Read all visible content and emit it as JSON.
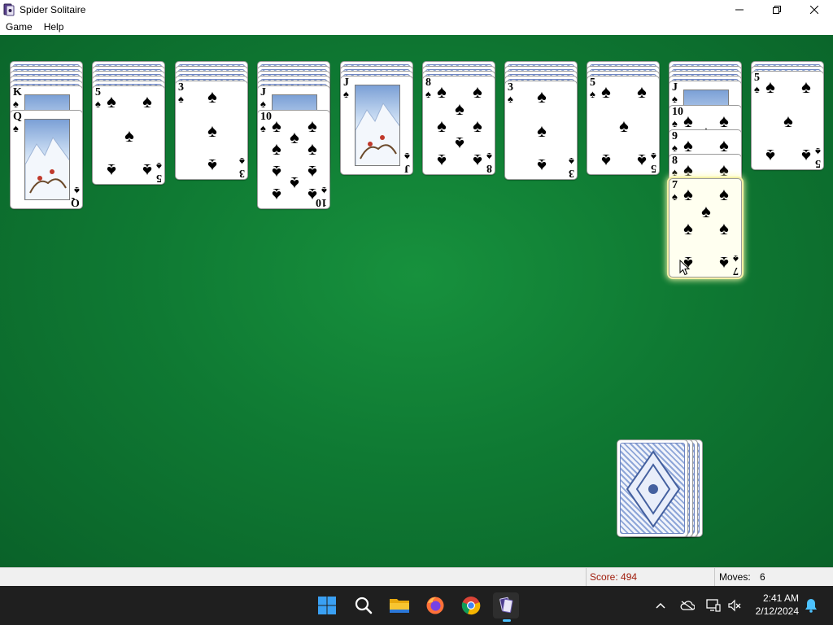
{
  "window": {
    "title": "Spider Solitaire",
    "controls": [
      "minimize-icon",
      "restore-icon",
      "close-icon"
    ]
  },
  "menu": [
    {
      "label": "Game"
    },
    {
      "label": "Help"
    }
  ],
  "colors": {
    "felt": "#0f7a33",
    "card_back": "#6f86c2",
    "score_text": "#a01d0c",
    "selected_glow": "#f4f0a6"
  },
  "columns": [
    {
      "facedown": 5,
      "cards": [
        {
          "rank": "K",
          "suit": "♠"
        },
        {
          "rank": "Q",
          "suit": "♠"
        }
      ]
    },
    {
      "facedown": 5,
      "cards": [
        {
          "rank": "5",
          "suit": "♠"
        }
      ]
    },
    {
      "facedown": 4,
      "cards": [
        {
          "rank": "3",
          "suit": "♠"
        }
      ]
    },
    {
      "facedown": 5,
      "cards": [
        {
          "rank": "J",
          "suit": "♠"
        },
        {
          "rank": "10",
          "suit": "♠"
        }
      ]
    },
    {
      "facedown": 3,
      "cards": [
        {
          "rank": "J",
          "suit": "♠"
        }
      ]
    },
    {
      "facedown": 3,
      "cards": [
        {
          "rank": "8",
          "suit": "♠"
        }
      ]
    },
    {
      "facedown": 4,
      "cards": [
        {
          "rank": "3",
          "suit": "♠"
        }
      ]
    },
    {
      "facedown": 3,
      "cards": [
        {
          "rank": "5",
          "suit": "♠"
        }
      ]
    },
    {
      "facedown": 4,
      "cards": [
        {
          "rank": "J",
          "suit": "♠"
        },
        {
          "rank": "10",
          "suit": "♠"
        },
        {
          "rank": "9",
          "suit": "♠"
        },
        {
          "rank": "8",
          "suit": "♠"
        },
        {
          "rank": "7",
          "suit": "♠",
          "selected": true
        }
      ]
    },
    {
      "facedown": 2,
      "cards": [
        {
          "rank": "5",
          "suit": "♠"
        }
      ]
    }
  ],
  "stock": {
    "piles": 4
  },
  "status": {
    "score": "Score: 494",
    "moves_label": "Moves:",
    "moves_value": "6"
  },
  "taskbar": {
    "apps": [
      "windows-start-icon",
      "search-icon",
      "file-explorer-icon",
      "firefox-icon",
      "chrome-icon",
      "spider-solitaire-icon"
    ],
    "tray": [
      "show-hidden-icons-chevron",
      "onedrive-icon",
      "network-icon",
      "volume-muted-icon",
      "notification-bell-icon"
    ],
    "time": "2:41 AM",
    "date": "2/12/2024"
  }
}
